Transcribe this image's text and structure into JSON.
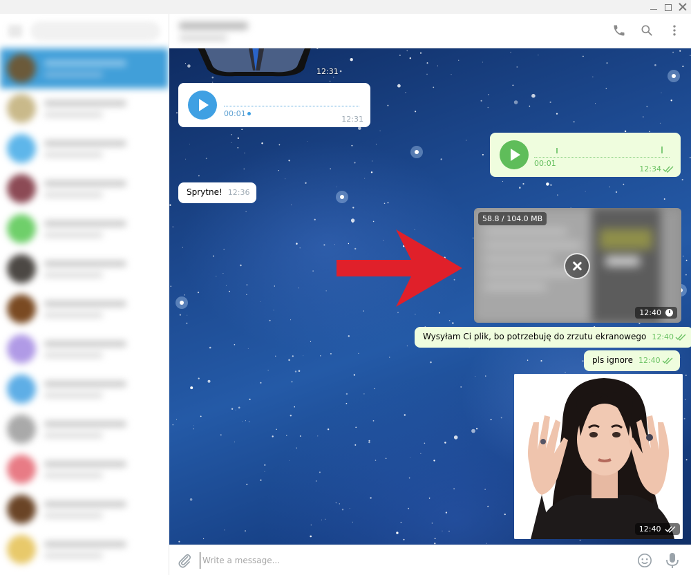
{
  "window": {
    "controls": [
      "minimize-icon",
      "maximize-icon",
      "close-icon"
    ]
  },
  "header": {
    "icons": [
      "phone-icon",
      "search-icon",
      "more-vertical-icon"
    ]
  },
  "messages": {
    "sticker_top_time": "12:31",
    "voice_in": {
      "duration": "00:01",
      "time": "12:31"
    },
    "voice_out": {
      "duration": "00:01",
      "time": "12:34"
    },
    "text_in": {
      "text": "Sprytne!",
      "time": "12:36"
    },
    "video": {
      "progress": "58.8 / 104.0 MB",
      "time": "12:40",
      "downloaded_mb": 58.8,
      "total_mb": 104.0
    },
    "text_out_1": {
      "text": "Wysyłam Ci plik, bo potrzebuję do zrzutu ekranowego",
      "time": "12:40"
    },
    "text_out_2": {
      "text": "pls ignore",
      "time": "12:40"
    },
    "sticker_bottom_time": "12:40"
  },
  "composer": {
    "placeholder": "Write a message...",
    "icons": [
      "paperclip-icon",
      "emoji-icon",
      "microphone-icon"
    ]
  },
  "colors": {
    "accent": "#419fd9",
    "outgoing_bubble": "#effdde",
    "incoming_bubble": "#ffffff",
    "arrow": "#e0202a"
  }
}
